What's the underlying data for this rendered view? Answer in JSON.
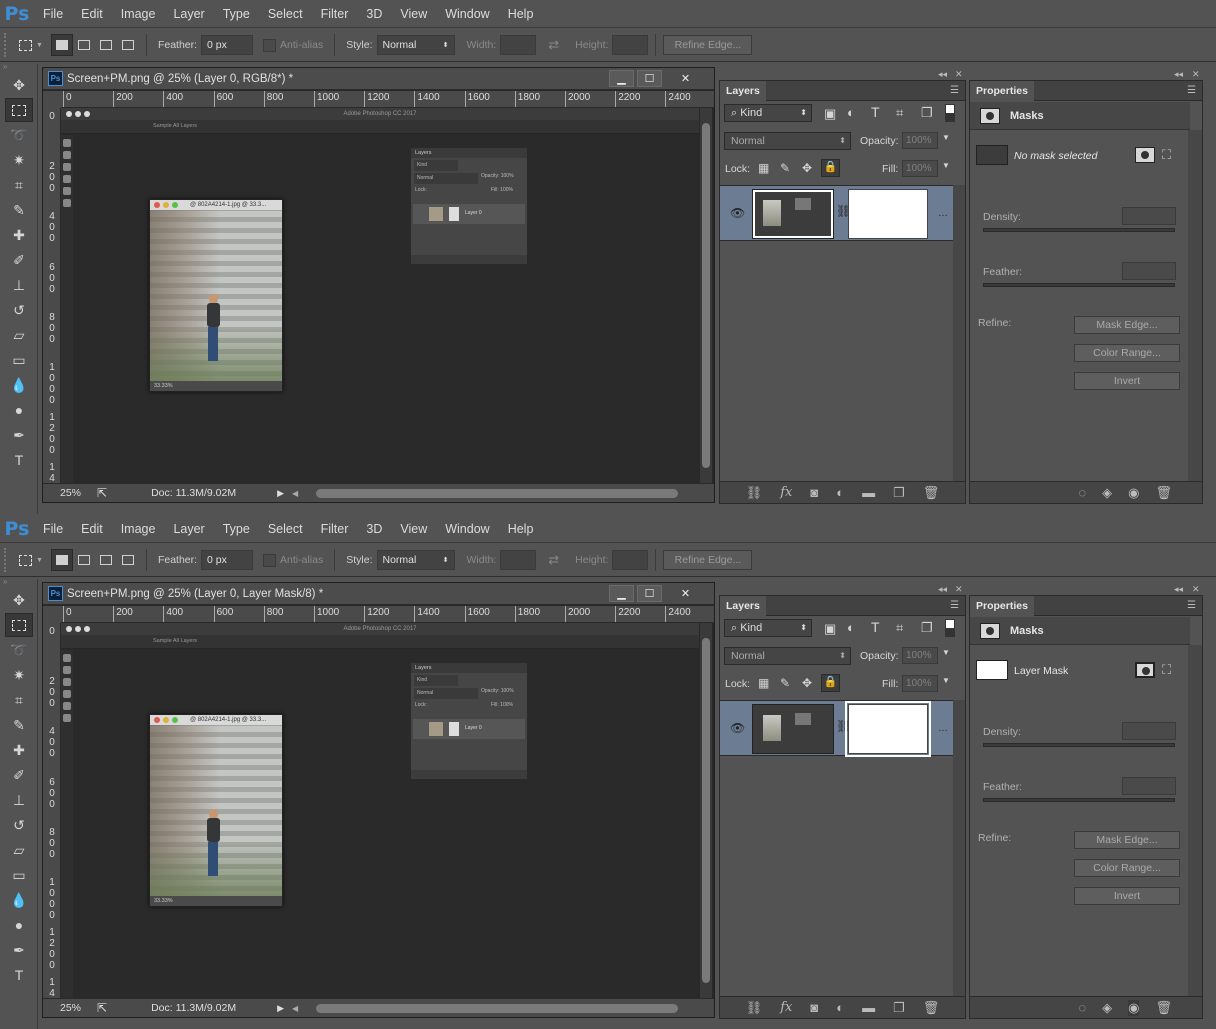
{
  "app": {
    "logo": "Ps"
  },
  "menu": [
    "File",
    "Edit",
    "Image",
    "Layer",
    "Type",
    "Select",
    "Filter",
    "3D",
    "View",
    "Window",
    "Help"
  ],
  "options": {
    "feather_label": "Feather:",
    "feather_value": "0 px",
    "antialias_label": "Anti-alias",
    "style_label": "Style:",
    "style_value": "Normal",
    "width_label": "Width:",
    "height_label": "Height:",
    "refine_edge": "Refine Edge..."
  },
  "ruler": {
    "h_ticks": [
      "0",
      "200",
      "400",
      "600",
      "800",
      "1000",
      "1200",
      "1400",
      "1600",
      "1800",
      "2000",
      "2200",
      "2400"
    ],
    "v_ticks": [
      "0",
      "2\n0\n0",
      "4\n0\n0",
      "6\n0\n0",
      "8\n0\n0",
      "1\n0\n0\n0",
      "1\n2\n0\n0",
      "1\n4"
    ]
  },
  "canvas": {
    "inner_app_title": "Adobe Photoshop CC 2017",
    "inner_sample": "Sample All Layers",
    "photo_title": "@ 802A4214-1.jpg @ 33.3...",
    "photo_zoom": "33.33%",
    "mini_layers_title": "Layers",
    "mini_kind": "Kind",
    "mini_normal": "Normal",
    "mini_opacity": "Opacity: 100%",
    "mini_lock": "Lock:",
    "mini_fill": "Fill: 100%",
    "mini_layer_name": "Layer 0"
  },
  "status": {
    "zoom": "25%",
    "doc": "Doc: 11.3M/9.02M"
  },
  "layers_panel": {
    "tab": "Layers",
    "kind": "Kind",
    "blend": "Normal",
    "opacity_label": "Opacity:",
    "opacity_value": "100%",
    "lock_label": "Lock:",
    "fill_label": "Fill:",
    "fill_value": "100%",
    "footer_icons": [
      "link-icon",
      "fx-icon",
      "mask-icon",
      "adjustment-icon",
      "folder-icon",
      "new-layer-icon",
      "trash-icon"
    ]
  },
  "props_panel": {
    "tab": "Properties",
    "section": "Masks",
    "density_label": "Density:",
    "feather_label": "Feather:",
    "refine_label": "Refine:",
    "mask_edge": "Mask Edge...",
    "color_range": "Color Range...",
    "invert": "Invert"
  },
  "states": [
    {
      "doc_title": "Screen+PM.png @ 25% (Layer 0, RGB/8*) *",
      "mask_status": "No mask selected",
      "mask_status_italic": true,
      "selected": "layer"
    },
    {
      "doc_title": "Screen+PM.png @ 25% (Layer 0, Layer Mask/8) *",
      "mask_status": "Layer Mask",
      "mask_status_italic": false,
      "selected": "mask"
    }
  ]
}
